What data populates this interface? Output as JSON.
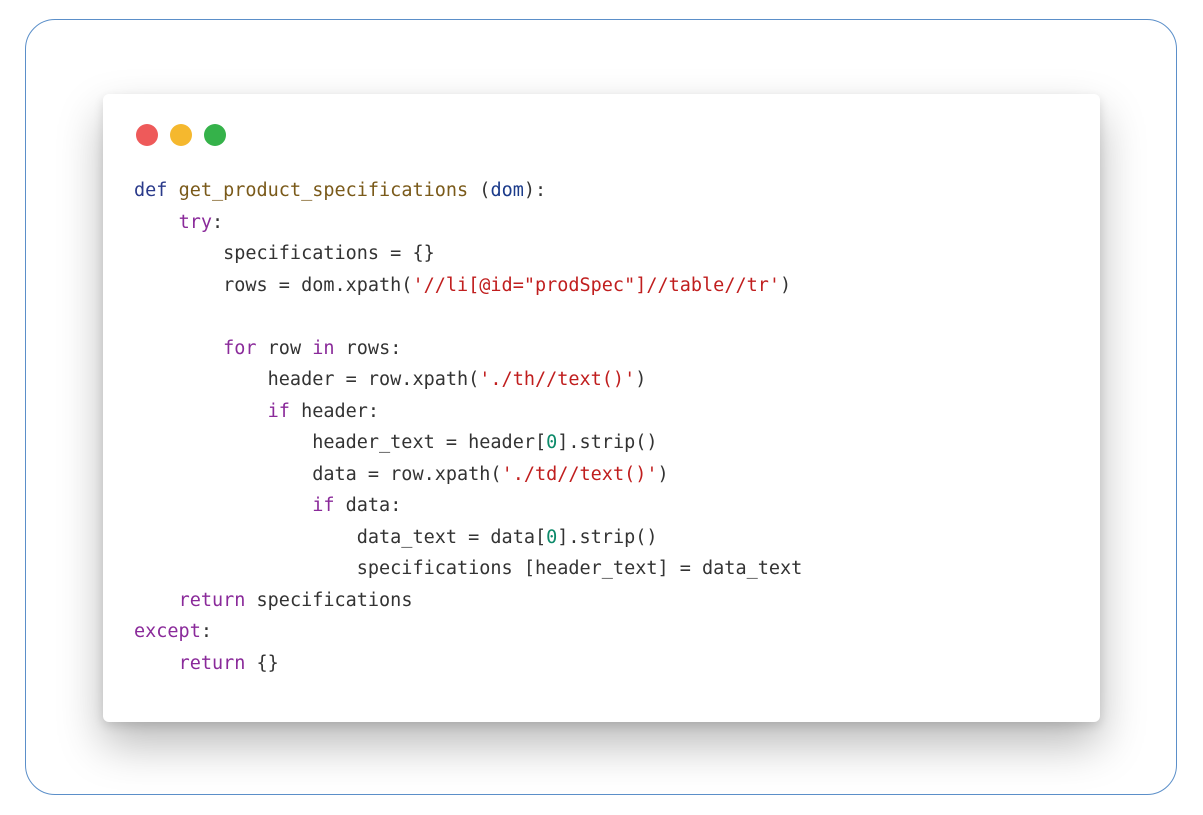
{
  "window": {
    "controls": [
      {
        "name": "close",
        "color": "#ee5a5a"
      },
      {
        "name": "minimize",
        "color": "#f5b82e"
      },
      {
        "name": "maximize",
        "color": "#35b24a"
      }
    ]
  },
  "code": {
    "language": "python",
    "lines": [
      [
        {
          "t": "def",
          "k": "kw"
        },
        {
          "t": " ",
          "k": "plain"
        },
        {
          "t": "get_product_specifications",
          "k": "fn"
        },
        {
          "t": " (",
          "k": "plain"
        },
        {
          "t": "dom",
          "k": "param"
        },
        {
          "t": "):",
          "k": "plain"
        }
      ],
      [
        {
          "t": "    ",
          "k": "plain"
        },
        {
          "t": "try",
          "k": "ctl"
        },
        {
          "t": ":",
          "k": "plain"
        }
      ],
      [
        {
          "t": "        specifications = {}",
          "k": "plain"
        }
      ],
      [
        {
          "t": "        rows = dom.xpath(",
          "k": "plain"
        },
        {
          "t": "'//li[@id=\"prodSpec\"]//table//tr'",
          "k": "str"
        },
        {
          "t": ")",
          "k": "plain"
        }
      ],
      [],
      [
        {
          "t": "        ",
          "k": "plain"
        },
        {
          "t": "for",
          "k": "ctl"
        },
        {
          "t": " row ",
          "k": "plain"
        },
        {
          "t": "in",
          "k": "ctl"
        },
        {
          "t": " rows:",
          "k": "plain"
        }
      ],
      [
        {
          "t": "            header = row.xpath(",
          "k": "plain"
        },
        {
          "t": "'./th//text()'",
          "k": "str"
        },
        {
          "t": ")",
          "k": "plain"
        }
      ],
      [
        {
          "t": "            ",
          "k": "plain"
        },
        {
          "t": "if",
          "k": "ctl"
        },
        {
          "t": " header:",
          "k": "plain"
        }
      ],
      [
        {
          "t": "                header_text = header[",
          "k": "plain"
        },
        {
          "t": "0",
          "k": "num"
        },
        {
          "t": "].strip()",
          "k": "plain"
        }
      ],
      [
        {
          "t": "                data = row.xpath(",
          "k": "plain"
        },
        {
          "t": "'./td//text()'",
          "k": "str"
        },
        {
          "t": ")",
          "k": "plain"
        }
      ],
      [
        {
          "t": "                ",
          "k": "plain"
        },
        {
          "t": "if",
          "k": "ctl"
        },
        {
          "t": " data:",
          "k": "plain"
        }
      ],
      [
        {
          "t": "                    data_text = data[",
          "k": "plain"
        },
        {
          "t": "0",
          "k": "num"
        },
        {
          "t": "].strip()",
          "k": "plain"
        }
      ],
      [
        {
          "t": "                    specifications [header_text] = data_text",
          "k": "plain"
        }
      ],
      [
        {
          "t": "    ",
          "k": "plain"
        },
        {
          "t": "return",
          "k": "ctl"
        },
        {
          "t": " specifications",
          "k": "plain"
        }
      ],
      [
        {
          "t": "except",
          "k": "ctl"
        },
        {
          "t": ":",
          "k": "plain"
        }
      ],
      [
        {
          "t": "    ",
          "k": "plain"
        },
        {
          "t": "return",
          "k": "ctl"
        },
        {
          "t": " {}",
          "k": "plain"
        }
      ]
    ]
  }
}
